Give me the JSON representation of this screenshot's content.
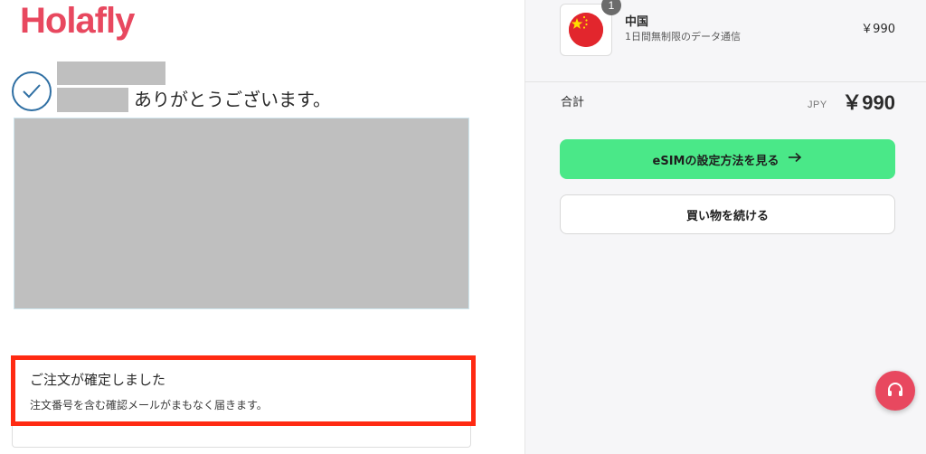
{
  "brand": {
    "logo_text": "Holafly",
    "logo_color": "#e8485f"
  },
  "confirmation": {
    "thanks_text": "ありがとうございます。",
    "order_title": "ご注文が確定しました",
    "order_subtitle": "注文番号を含む確認メールがまもなく届きます。"
  },
  "cart": {
    "item": {
      "name": "中国",
      "description": "1日間無制限のデータ通信",
      "price": "￥990",
      "quantity": "1",
      "flag_icon": "china-flag-icon"
    },
    "total": {
      "label": "合計",
      "currency": "JPY",
      "amount": "￥990"
    }
  },
  "actions": {
    "primary_label": "eSIMの設定方法を見る",
    "primary_icon": "arrow-right-icon",
    "secondary_label": "買い物を続ける"
  },
  "colors": {
    "primary_button": "#4ae888",
    "highlight_border": "#ff2a12",
    "accent": "#e8485f"
  }
}
